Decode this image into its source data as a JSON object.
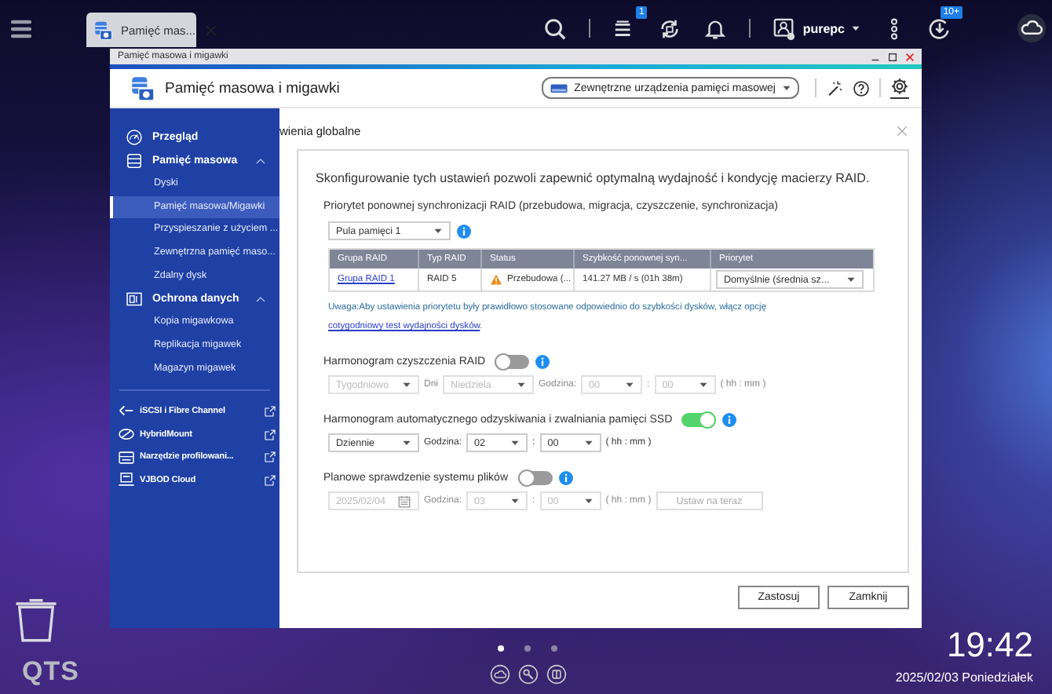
{
  "topbar": {
    "tab_title": "Pamięć mas...",
    "storage_badge": "1",
    "user": "purepc",
    "update_badge": "10+"
  },
  "window": {
    "title": "Pamięć masowa i migawki",
    "app_title": "Pamięć masowa i migawki",
    "device_menu": "Zewnętrzne urządzenia pamięci masowej"
  },
  "sidebar": {
    "items": [
      {
        "kind": "page",
        "label": "Przegląd",
        "selected": false
      },
      {
        "kind": "group",
        "label": "Pamięć masowa",
        "selected": false,
        "expanded": true,
        "children": [
          {
            "label": "Dyski",
            "selected": false
          },
          {
            "label": "Pamięć masowa/Migawki",
            "selected": true
          },
          {
            "label": "Przyspieszanie z użyciem ...",
            "selected": false
          },
          {
            "label": "Zewnętrzna pamięć maso...",
            "selected": false
          },
          {
            "label": "Zdalny dysk",
            "selected": false
          }
        ]
      },
      {
        "kind": "group",
        "label": "Ochrona danych",
        "selected": false,
        "expanded": true,
        "children": [
          {
            "label": "Kopia migawkowa",
            "selected": false
          },
          {
            "label": "Replikacja migawek",
            "selected": false
          },
          {
            "label": "Magazyn migawek",
            "selected": false
          }
        ]
      }
    ],
    "links": [
      {
        "label": "iSCSI i Fibre Channel"
      },
      {
        "label": "HybridMount"
      },
      {
        "label": "Narzędzie profilowani..."
      },
      {
        "label": "VJBOD Cloud"
      }
    ]
  },
  "dialog": {
    "title": "wienia globalne",
    "intro": "Skonfigurowanie tych ustawień pozwoli zapewnić optymalną wydajność i kondycję macierzy RAID.",
    "priority_label": "Priorytet ponownej synchronizacji RAID (przebudowa, migracja, czyszczenie, synchronizacja)",
    "pool": "Pula pamięci 1",
    "table": {
      "columns": [
        "Grupa RAID",
        "Typ RAID",
        "Status",
        "Szybkość ponownej syn...",
        "Priorytet"
      ],
      "rows": [
        {
          "group": "Grupa RAID 1",
          "type": "RAID 5",
          "status": "Przebudowa (...",
          "speed": "141.27 MB / s (01h 38m)",
          "priority": "Domyślnie (średnia sz..."
        }
      ]
    },
    "note": "Uwaga:Aby ustawienia priorytetu były prawidłowo stosowane odpowiednio do szybkości dysków, włącz opcję",
    "note_link": "cotygodniowy test wydajności dysków",
    "note_end": ".",
    "schedules": [
      {
        "label": "Harmonogram czyszczenia RAID",
        "on": false,
        "fields": [
          {
            "kind": "period",
            "value": "Tygodniowo"
          },
          {
            "kind": "label",
            "text": "Dni"
          },
          {
            "kind": "period",
            "value": "Niedziela"
          },
          {
            "kind": "label",
            "text": "Godzina:"
          },
          {
            "kind": "time",
            "value": "00"
          },
          {
            "kind": "label",
            "text": ":"
          },
          {
            "kind": "time",
            "value": "00"
          },
          {
            "kind": "label",
            "text": "( hh : mm )"
          }
        ]
      },
      {
        "label": "Harmonogram automatycznego odzyskiwania i zwalniania pamięci SSD",
        "on": true,
        "fields": [
          {
            "kind": "period",
            "value": "Dziennie"
          },
          {
            "kind": "label",
            "text": "Godzina:"
          },
          {
            "kind": "time",
            "value": "02"
          },
          {
            "kind": "label",
            "text": ":"
          },
          {
            "kind": "time",
            "value": "00"
          },
          {
            "kind": "label",
            "text": "( hh : mm )"
          }
        ]
      },
      {
        "label": "Planowe sprawdzenie systemu plików",
        "on": false,
        "fields": [
          {
            "kind": "date",
            "value": "2025/02/04"
          },
          {
            "kind": "label",
            "text": "Godzina:"
          },
          {
            "kind": "time",
            "value": "03"
          },
          {
            "kind": "label",
            "text": ":"
          },
          {
            "kind": "time",
            "value": "00"
          },
          {
            "kind": "label",
            "text": "( hh : mm )"
          },
          {
            "kind": "button",
            "text": "Ustaw na teraz"
          }
        ]
      }
    ],
    "buttons": [
      "Zastosuj",
      "Zamknij"
    ]
  },
  "desktop": {
    "brand": "QTS",
    "time": "19:42",
    "date": "2025/02/03 Poniedziałek",
    "pages": [
      {
        "selected": true
      },
      {
        "selected": false
      },
      {
        "selected": false
      }
    ]
  }
}
